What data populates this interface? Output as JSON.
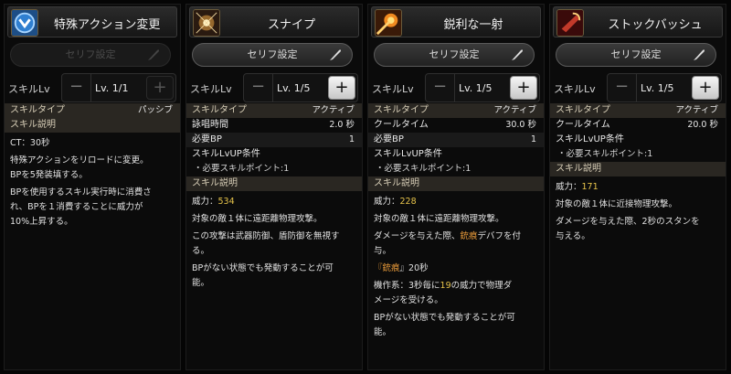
{
  "labels": {
    "serif": "セリフ設定",
    "skill_lv": "スキルLv",
    "minus": "−",
    "plus": "+"
  },
  "panels": [
    {
      "title": "特殊アクション変更",
      "level": "Lv. 1/1",
      "serif_enabled": false,
      "plus_enabled": false,
      "rows": [
        {
          "k": "スキルタイプ",
          "v": "パッシブ",
          "style": "hd"
        },
        {
          "k": "スキル説明",
          "v": "",
          "style": "hd"
        }
      ],
      "desc": [
        "CT：30秒",
        "特殊アクションをリロードに変更。",
        "BPを5発装填する。",
        "BPを使用するスキル実行時に消費さ",
        "れ、BPを１消費することに威力が",
        "10%上昇する。"
      ]
    },
    {
      "title": "スナイプ",
      "level": "Lv. 1/5",
      "serif_enabled": true,
      "plus_enabled": true,
      "rows": [
        {
          "k": "スキルタイプ",
          "v": "アクティブ",
          "style": "hd"
        },
        {
          "k": "詠唱時間",
          "v": "2.0 秒",
          "style": ""
        },
        {
          "k": "必要BP",
          "v": "1",
          "style": "bar"
        },
        {
          "k": "スキルLvUP条件",
          "v": "",
          "style": ""
        },
        {
          "k": "・必要スキルポイント:1",
          "v": "",
          "style": "sub"
        },
        {
          "k": "スキル説明",
          "v": "",
          "style": "hd"
        }
      ],
      "power_label": "威力：",
      "power": "534",
      "desc": [
        "対象の敵１体に遠距離物理攻撃。",
        "この攻撃は武器防御、盾防御を無視す",
        "る。",
        "BPがない状態でも発動することが可",
        "能。"
      ]
    },
    {
      "title": "鋭利な一射",
      "level": "Lv. 1/5",
      "serif_enabled": true,
      "plus_enabled": true,
      "rows": [
        {
          "k": "スキルタイプ",
          "v": "アクティブ",
          "style": "hd"
        },
        {
          "k": "クールタイム",
          "v": "30.0 秒",
          "style": ""
        },
        {
          "k": "必要BP",
          "v": "1",
          "style": "bar"
        },
        {
          "k": "スキルLvUP条件",
          "v": "",
          "style": ""
        },
        {
          "k": "・必要スキルポイント:1",
          "v": "",
          "style": "sub"
        },
        {
          "k": "スキル説明",
          "v": "",
          "style": "hd"
        }
      ],
      "power_label": "威力：",
      "power": "228",
      "desc_rich": {
        "l1": "対象の敵１体に遠距離物理攻撃。",
        "l2a": "ダメージを与えた際、",
        "l2b": "銃痕",
        "l2c": "デバフを付",
        "l3": "与。",
        "l4a": "『",
        "l4b": "銃痕",
        "l4c": "』20秒",
        "l5a": "機作系：3秒毎に",
        "l5b": "19",
        "l5c": "の威力で物理ダ",
        "l6": "メージを受ける。",
        "l7": "BPがない状態でも発動することが可",
        "l8": "能。"
      }
    },
    {
      "title": "ストックバッシュ",
      "level": "Lv. 1/5",
      "serif_enabled": true,
      "plus_enabled": true,
      "rows": [
        {
          "k": "スキルタイプ",
          "v": "アクティブ",
          "style": "hd"
        },
        {
          "k": "クールタイム",
          "v": "20.0 秒",
          "style": ""
        },
        {
          "k": "スキルLvUP条件",
          "v": "",
          "style": ""
        },
        {
          "k": "・必要スキルポイント:1",
          "v": "",
          "style": "sub"
        },
        {
          "k": "スキル説明",
          "v": "",
          "style": "hd"
        }
      ],
      "power_label": "威力：",
      "power": "171",
      "desc": [
        "対象の敵１体に近接物理攻撃。",
        "ダメージを与えた際、2秒のスタンを",
        "与える。"
      ]
    }
  ]
}
